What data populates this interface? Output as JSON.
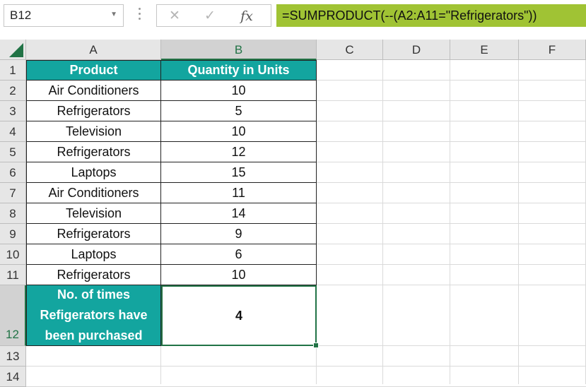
{
  "name_box": {
    "value": "B12"
  },
  "formula_bar": {
    "cancel_symbol": "✕",
    "enter_symbol": "✓",
    "fx_symbol": "fx",
    "formula": "=SUMPRODUCT(--(A2:A11=\"Refrigerators\"))"
  },
  "columns": [
    "A",
    "B",
    "C",
    "D",
    "E",
    "F"
  ],
  "selected_column": "B",
  "rows": [
    "1",
    "2",
    "3",
    "4",
    "5",
    "6",
    "7",
    "8",
    "9",
    "10",
    "11",
    "12",
    "13",
    "14"
  ],
  "selected_row": "12",
  "table": {
    "headers": [
      "Product",
      "Quantity in Units"
    ],
    "data": [
      [
        "Air Conditioners",
        "10"
      ],
      [
        "Refrigerators",
        "5"
      ],
      [
        "Television",
        "10"
      ],
      [
        "Refrigerators",
        "12"
      ],
      [
        "Laptops",
        "15"
      ],
      [
        "Air Conditioners",
        "11"
      ],
      [
        "Television",
        "14"
      ],
      [
        "Refrigerators",
        "9"
      ],
      [
        "Laptops",
        "6"
      ],
      [
        "Refrigerators",
        "10"
      ]
    ],
    "summary_label_lines": [
      "No. of times",
      "Refigerators have",
      "been purchased"
    ],
    "summary_value": "4"
  },
  "colors": {
    "header_fill": "#13a59f",
    "formula_highlight": "#a0c334",
    "selection": "#217346"
  }
}
